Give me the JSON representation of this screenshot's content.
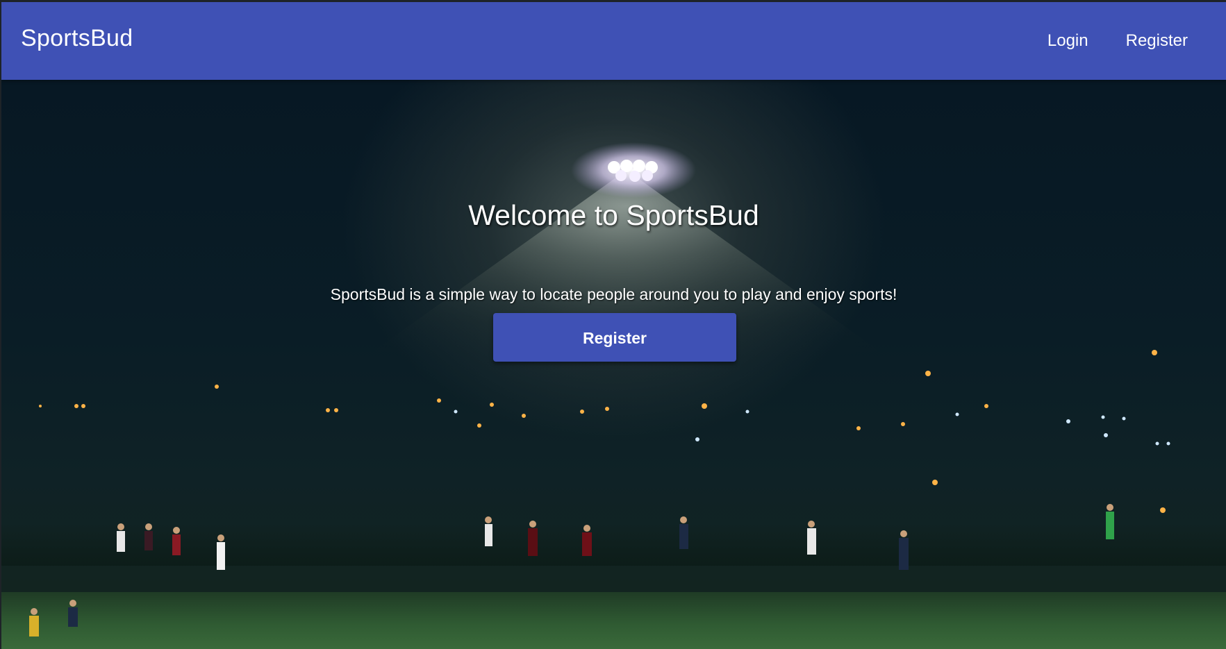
{
  "navbar": {
    "brand": "SportsBud",
    "links": [
      {
        "label": "Login"
      },
      {
        "label": "Register"
      }
    ],
    "background_color": "#3f51b5"
  },
  "hero": {
    "title": "Welcome to SportsBud",
    "subtitle": "SportsBud is a simple way to locate people around you to play and enjoy sports!",
    "cta_label": "Register",
    "background_image": "night-soccer-field-photo"
  }
}
